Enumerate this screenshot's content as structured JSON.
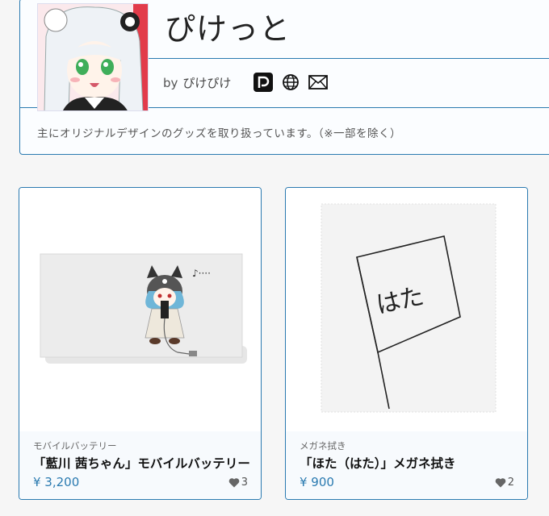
{
  "shop": {
    "title": "ぴけっと",
    "by_label": "by",
    "owner": "ぴけぴけ",
    "description": "主にオリジナルデザインのグッズを取り扱っています。（※一部を除く）",
    "social_icons": [
      "pixiv-icon",
      "globe-icon",
      "mail-icon"
    ]
  },
  "products": [
    {
      "category": "モバイルバッテリー",
      "name": "「藍川 茜ちゃん」モバイルバッテリー",
      "price": "¥ 3,200",
      "likes": "3",
      "image_text": "♪····"
    },
    {
      "category": "メガネ拭き",
      "name": "「ほた（はた）」メガネ拭き",
      "price": "¥ 900",
      "likes": "2",
      "image_text": "はた"
    }
  ],
  "colors": {
    "accent": "#2a7ab0",
    "background": "#f6f6f6"
  }
}
